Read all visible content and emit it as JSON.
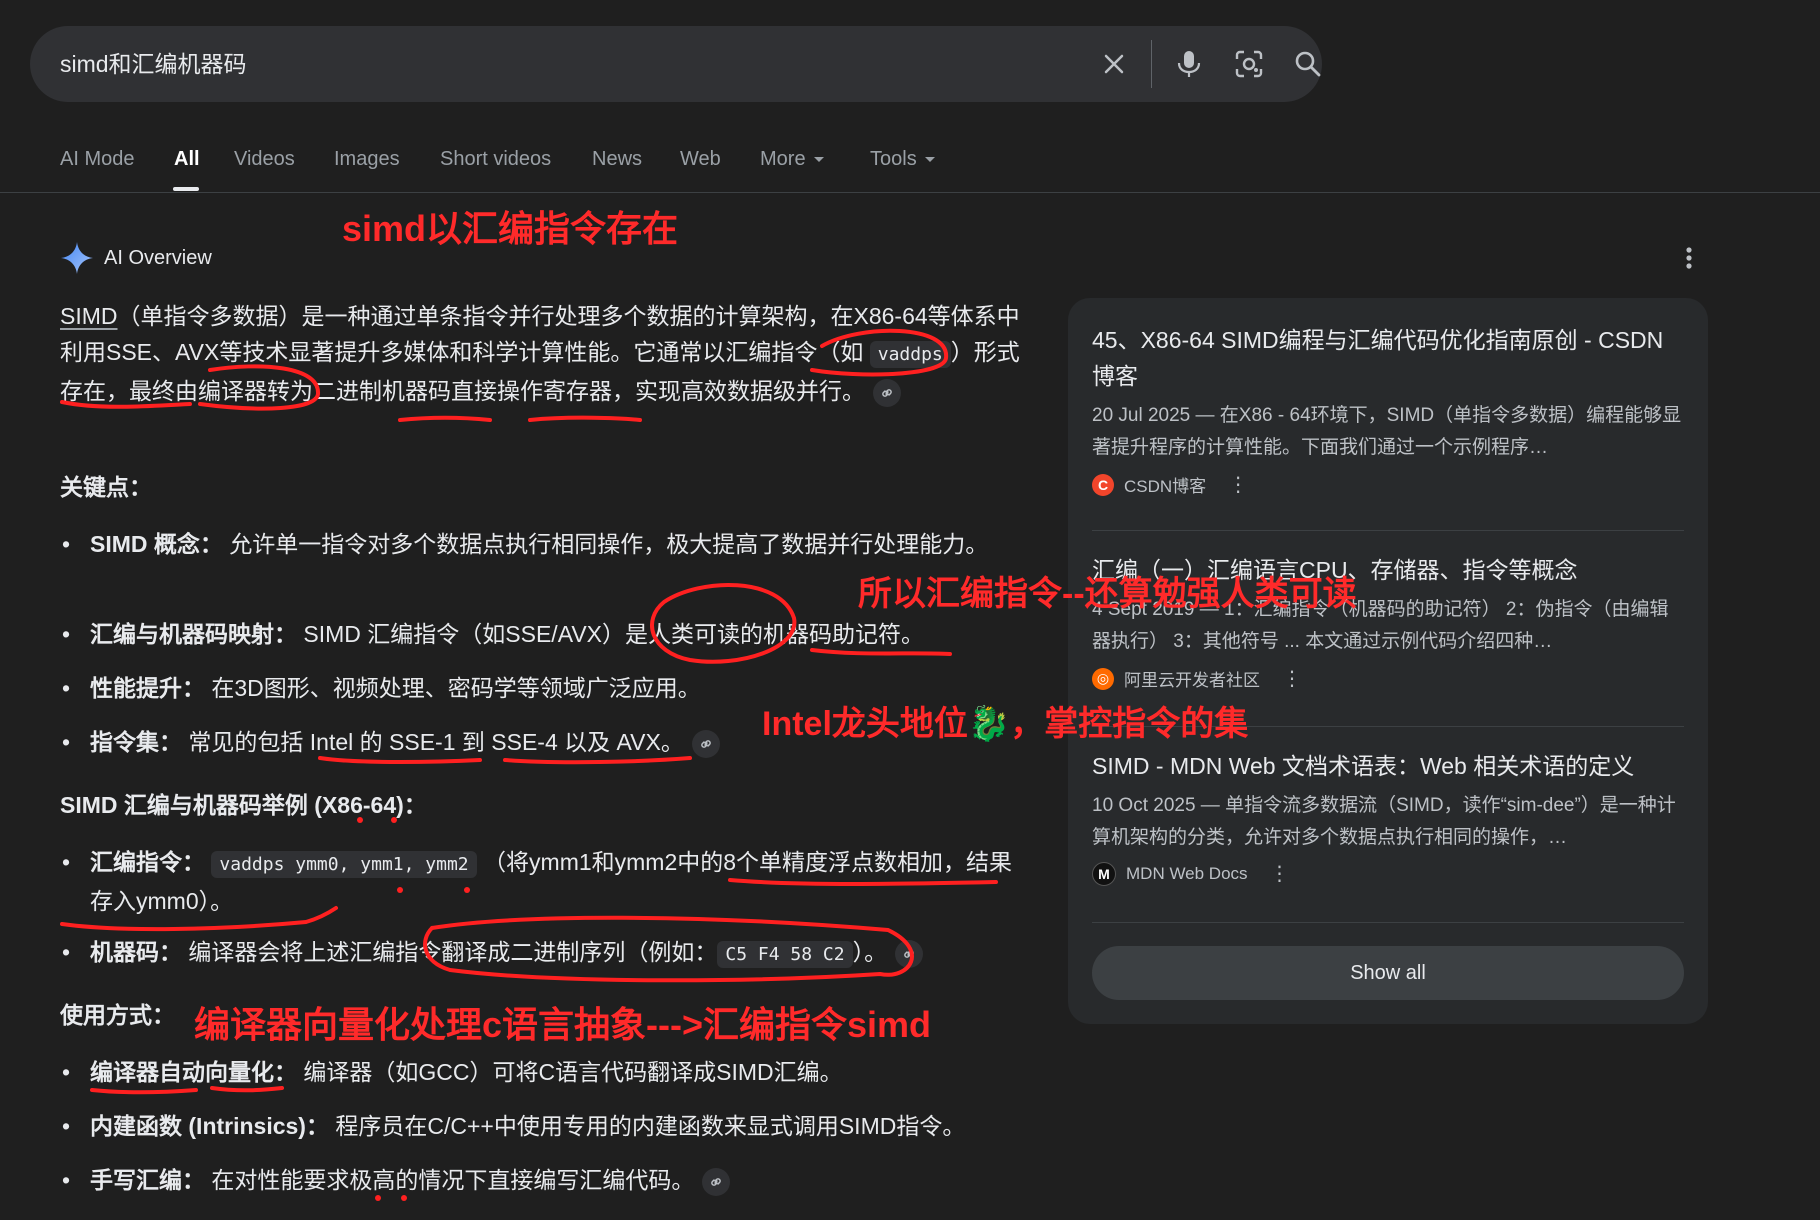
{
  "search": {
    "query": "simd和汇编机器码"
  },
  "tabs": [
    "AI Mode",
    "All",
    "Videos",
    "Images",
    "Short videos",
    "News",
    "Web",
    "More",
    "Tools"
  ],
  "ai_overview": {
    "title": "AI Overview",
    "intro": {
      "p1": "SIMD",
      "p2": "（单指令多数据）是一种通过单条指令并行处理多个数据的计算架构，在X86-64等体系中利用SSE、AVX等技术显著提升多媒体和科学计算性能。它通常以汇编指令（如 ",
      "code": "vaddps",
      "p3": "）形式存在，最终由编译器转为二进制机器码直接操作寄存器，实现高效数据级并行。"
    },
    "key_points_heading": "关键点：",
    "key_points": [
      {
        "label": "SIMD 概念：",
        "text": "允许单一指令对多个数据点执行相同操作，极大提高了数据并行处理能力。"
      },
      {
        "label": "汇编与机器码映射：",
        "text": "SIMD 汇编指令（如SSE/AVX）是人类可读的机器码助记符。"
      },
      {
        "label": "性能提升：",
        "text": "在3D图形、视频处理、密码学等领域广泛应用。"
      },
      {
        "label": "指令集：",
        "text": "常见的包括 Intel 的 SSE-1 到 SSE-4 以及 AVX。"
      }
    ],
    "example_heading": "SIMD 汇编与机器码举例 (X86-64)：",
    "examples": {
      "asm_label": "汇编指令：",
      "asm_code": "vaddps ymm0, ymm1, ymm2",
      "asm_text": "（将ymm1和ymm2中的8个单精度浮点数相加，结果存入ymm0）。",
      "mc_label": "机器码：",
      "mc_text1": "编译器会将上述汇编指令翻译成二进制序列（例如：",
      "mc_code": "C5 F4 58 C2",
      "mc_text2": "）。"
    },
    "usage_heading": "使用方式：",
    "usage": [
      {
        "label": "编译器自动向量化：",
        "text": "编译器（如GCC）可将C语言代码翻译成SIMD汇编。"
      },
      {
        "label": "内建函数 (Intrinsics)：",
        "text": "程序员在C/C++中使用专用的内建函数来显式调用SIMD指令。"
      },
      {
        "label": "手写汇编：",
        "text": "在对性能要求极高的情况下直接编写汇编代码。"
      }
    ]
  },
  "sources": [
    {
      "title": "45、X86-64 SIMD编程与汇编代码优化指南原创 - CSDN博客",
      "snippet": "20 Jul 2025 — 在X86 - 64环境下，SIMD（单指令多数据）编程能够显著提升程序的计算性能。下面我们通过一个示例程序…",
      "site": "CSDN博客",
      "favicon": "C",
      "color": "#f2452b"
    },
    {
      "title": "汇编（一）汇编语言CPU、存储器、指令等概念",
      "snippet": "4 Sept 2019 — 1：汇编指令（机器码的助记符） 2：伪指令（由编辑器执行） 3：其他符号 ... 本文通过示例代码介绍四种…",
      "site": "阿里云开发者社区",
      "favicon": "◎",
      "color": "#ff6a00"
    },
    {
      "title": "SIMD - MDN Web 文档术语表：Web 相关术语的定义",
      "snippet": "10 Oct 2025 — 单指令流多数据流（SIMD，读作“sim-dee”）是一种计算机架构的分类，允许对多个数据点执行相同的操作，…",
      "site": "MDN Web Docs",
      "favicon": "M",
      "color": "#111111"
    }
  ],
  "show_all": "Show all",
  "annotations": {
    "a1": "simd以汇编指令存在",
    "a2": "所以汇编指令--还算勉强人类可读",
    "a3": "Intel龙头地位🐉，掌控指令的集",
    "a4": "编译器向量化处理c语言抽象--->汇编指令simd"
  },
  "colors": {
    "background": "#1f1f1f",
    "annotation": "#ff2a2a",
    "accent": "#8ab4f8"
  }
}
